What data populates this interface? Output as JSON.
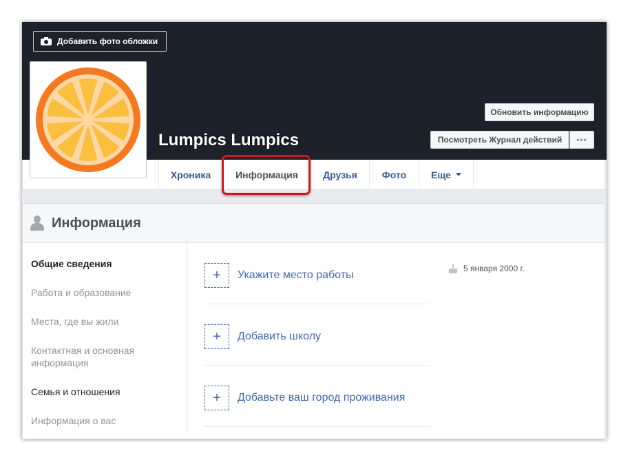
{
  "cover": {
    "add_photo_label": "Добавить фото обложки"
  },
  "profile": {
    "name": "Lumpics Lumpics"
  },
  "actions": {
    "update_info_label": "Обновить информацию",
    "activity_log_label": "Посмотреть Журнал действий",
    "more_label": "•••"
  },
  "tabs": [
    {
      "label": "Хроника"
    },
    {
      "label": "Информация",
      "active": true
    },
    {
      "label": "Друзья"
    },
    {
      "label": "Фото"
    },
    {
      "label": "Еще"
    }
  ],
  "about": {
    "title": "Информация",
    "sections": [
      {
        "label": "Общие сведения"
      },
      {
        "label": "Работа и образование"
      },
      {
        "label": "Места, где вы жили"
      },
      {
        "label": "Контактная и основная информация"
      },
      {
        "label": "Семья и отношения"
      },
      {
        "label": "Информация о вас"
      }
    ],
    "add_items": [
      {
        "icon": "+",
        "label": "Укажите место работы"
      },
      {
        "icon": "+",
        "label": "Добавить школу"
      },
      {
        "icon": "+",
        "label": "Добавьте ваш город проживания"
      }
    ],
    "birthday": "5 января 2000 г."
  },
  "colors": {
    "cover_bg": "#1d2129",
    "link_blue": "#365899",
    "add_blue": "#4267b2",
    "highlight_red": "#d0181b",
    "orange_rind": "#f47920",
    "orange_flesh": "#fbbf3f"
  }
}
